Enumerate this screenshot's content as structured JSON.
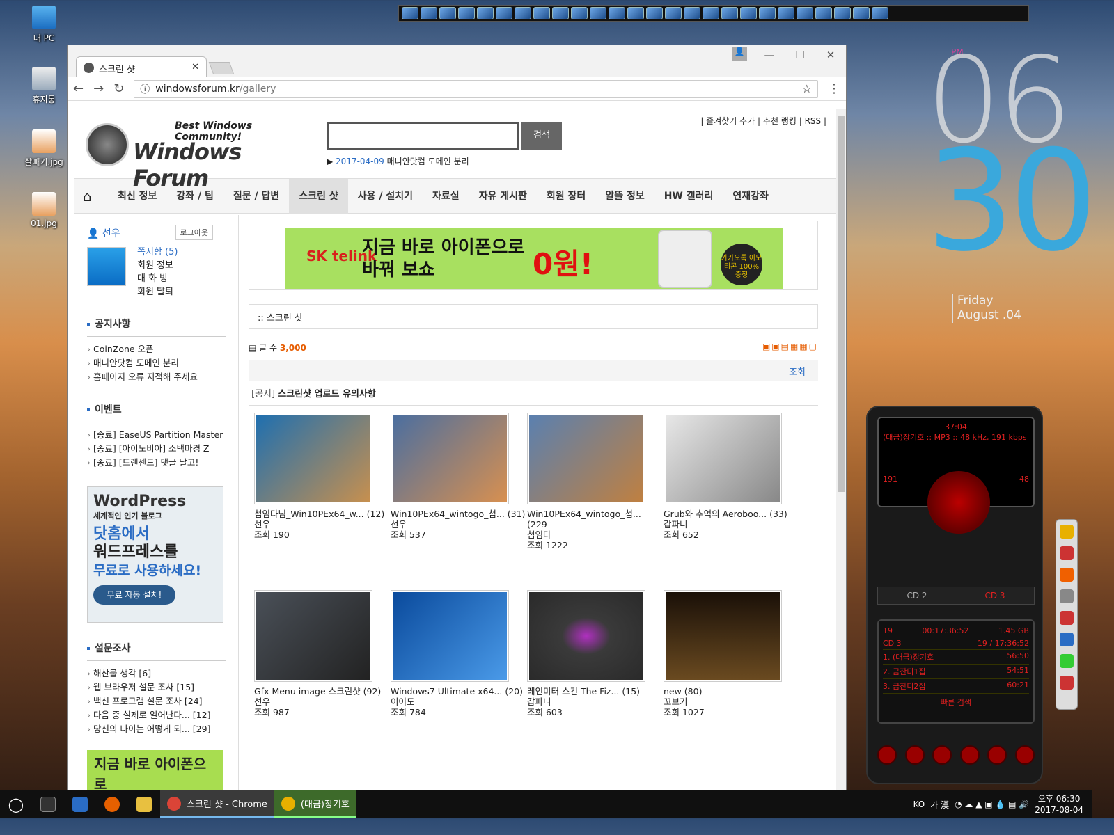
{
  "desktop": {
    "icons": [
      {
        "label": "내 PC"
      },
      {
        "label": "휴지통"
      },
      {
        "label": "살빼기.jpg"
      },
      {
        "label": "01.jpg"
      }
    ]
  },
  "clock_widget": {
    "ampm": "PM",
    "hour": "06",
    "minute": "30",
    "day": "Friday",
    "date": "August .04"
  },
  "browser": {
    "tab_title": "스크린 샷",
    "url_host": "windowsforum.kr",
    "url_path": "/gallery"
  },
  "site": {
    "slogan": "Best Windows Community!",
    "name": "Windows Forum",
    "search_button": "검색",
    "notice_date": "2017-04-09",
    "notice_text": "매니안닷컴 도메인 분리",
    "top_links": [
      "즐겨찾기 추가",
      "추천 랭킹",
      "RSS"
    ],
    "nav": [
      "최신 정보",
      "강좌 / 팁",
      "질문 / 답변",
      "스크린 샷",
      "사용 / 설치기",
      "자료실",
      "자유 게시판",
      "회원 장터",
      "알뜰 정보",
      "HW 갤러리",
      "연재강좌"
    ]
  },
  "sidebar": {
    "user": "선우",
    "logout": "로그아웃",
    "user_links": [
      "쪽지함 (5)",
      "회원 정보",
      "대 화 방",
      "회원 탈퇴"
    ],
    "notice_title": "공지사항",
    "notices": [
      "CoinZone 오픈",
      "매니안닷컴 도메인 분리",
      "홈페이지 오류 지적해 주세요"
    ],
    "event_title": "이벤트",
    "events": [
      "[종료] EaseUS Partition Master",
      "[종료] [아이노비아] 소택마경 Z",
      "[종료] [트랜센드] 댓글 달고!"
    ],
    "ad": {
      "brand": "WordPress",
      "tag": "세계적인 인기 블로그",
      "l1": "닷홈에서",
      "l2": "워드프레스를",
      "l3": "무료로 사용하세요!",
      "btn": "무료 자동 설치!"
    },
    "poll_title": "설문조사",
    "polls": [
      "해산물 생각 [6]",
      "웹 브라우저 설문 조사 [15]",
      "백신 프로그램 설문 조사 [24]",
      "다음 중 실제로 일어난다... [12]",
      "당신의 나이는 어떻게 되... [29]"
    ],
    "ad2": "지금 바로 아이폰으로"
  },
  "main": {
    "banner": {
      "brand": "SK telink",
      "l1": "지금 바로 아이폰으로",
      "l2": "바꿔 보쇼",
      "won": "0원!",
      "coin": "카카오톡 이모티콘 100% 증정"
    },
    "crumb": "스크린 샷",
    "count_label": "글 수",
    "count": "3,000",
    "col_views": "조회",
    "notice_tag": "[공지]",
    "notice_title": "스크린샷 업로드 유의사항",
    "items": [
      {
        "title": "첨임다님_Win10PEx64_w... (12)",
        "author": "선우",
        "views": "조회 190",
        "c1": "#1e6fb0",
        "c2": "#c8904e"
      },
      {
        "title": "Win10PEx64_wintogo_첨... (31)",
        "author": "선우",
        "views": "조회 537",
        "c1": "#4a6ea0",
        "c2": "#d89050"
      },
      {
        "title": "Win10PEx64_wintogo_첨... (229",
        "author": "첨임다",
        "views": "조회 1222",
        "c1": "#5a80b0",
        "c2": "#c08040"
      },
      {
        "title": "Grub와 추억의 Aeroboo... (33)",
        "author": "갑파니",
        "views": "조회 652",
        "c1": "#e8e8e8",
        "c2": "#888888"
      },
      {
        "title": "Gfx Menu image 스크린샷 (92)",
        "author": "선우",
        "views": "조회 987",
        "c1": "#4a5058",
        "c2": "#222222"
      },
      {
        "title": "Windows7 Ultimate x64... (20)",
        "author": "이어도",
        "views": "조회 784",
        "c1": "#0a4a9c",
        "c2": "#4a9ae8"
      },
      {
        "title": "레인미터 스킨 The Fiz... (15)",
        "author": "갑파니",
        "views": "조회 603",
        "c1": "#3a3a3a",
        "c2": "#2a2a2a"
      },
      {
        "title": "new (80)",
        "author": "꼬브기",
        "views": "조회 1027",
        "c1": "#1a1008",
        "c2": "#6a4a20"
      }
    ]
  },
  "player": {
    "time": "37:04",
    "track": "(대금)장기호 :: MP3 :: 48 kHz, 191 kbps",
    "kbps": "191",
    "khz": "48",
    "cd2": "CD 2",
    "cd3": "CD 3",
    "pl_header": [
      "19",
      "00:17:36:52",
      "1.45 GB"
    ],
    "pl_cd": "CD 3",
    "pl_cd_info": "19 / 17:36:52",
    "tracks": [
      {
        "name": "1. (대금)장기호",
        "time": "56:50"
      },
      {
        "name": "2. 금잔디1집",
        "time": "54:51"
      },
      {
        "name": "3. 금잔디2집",
        "time": "60:21"
      }
    ],
    "search": "빠른 검색"
  },
  "taskbar": {
    "apps": [
      {
        "label": "스크린 샷 - Chrome"
      },
      {
        "label": "(대금)장기호"
      }
    ],
    "ime": "KO",
    "ime2": "가 漢",
    "time": "오후 06:30",
    "date": "2017-08-04"
  }
}
